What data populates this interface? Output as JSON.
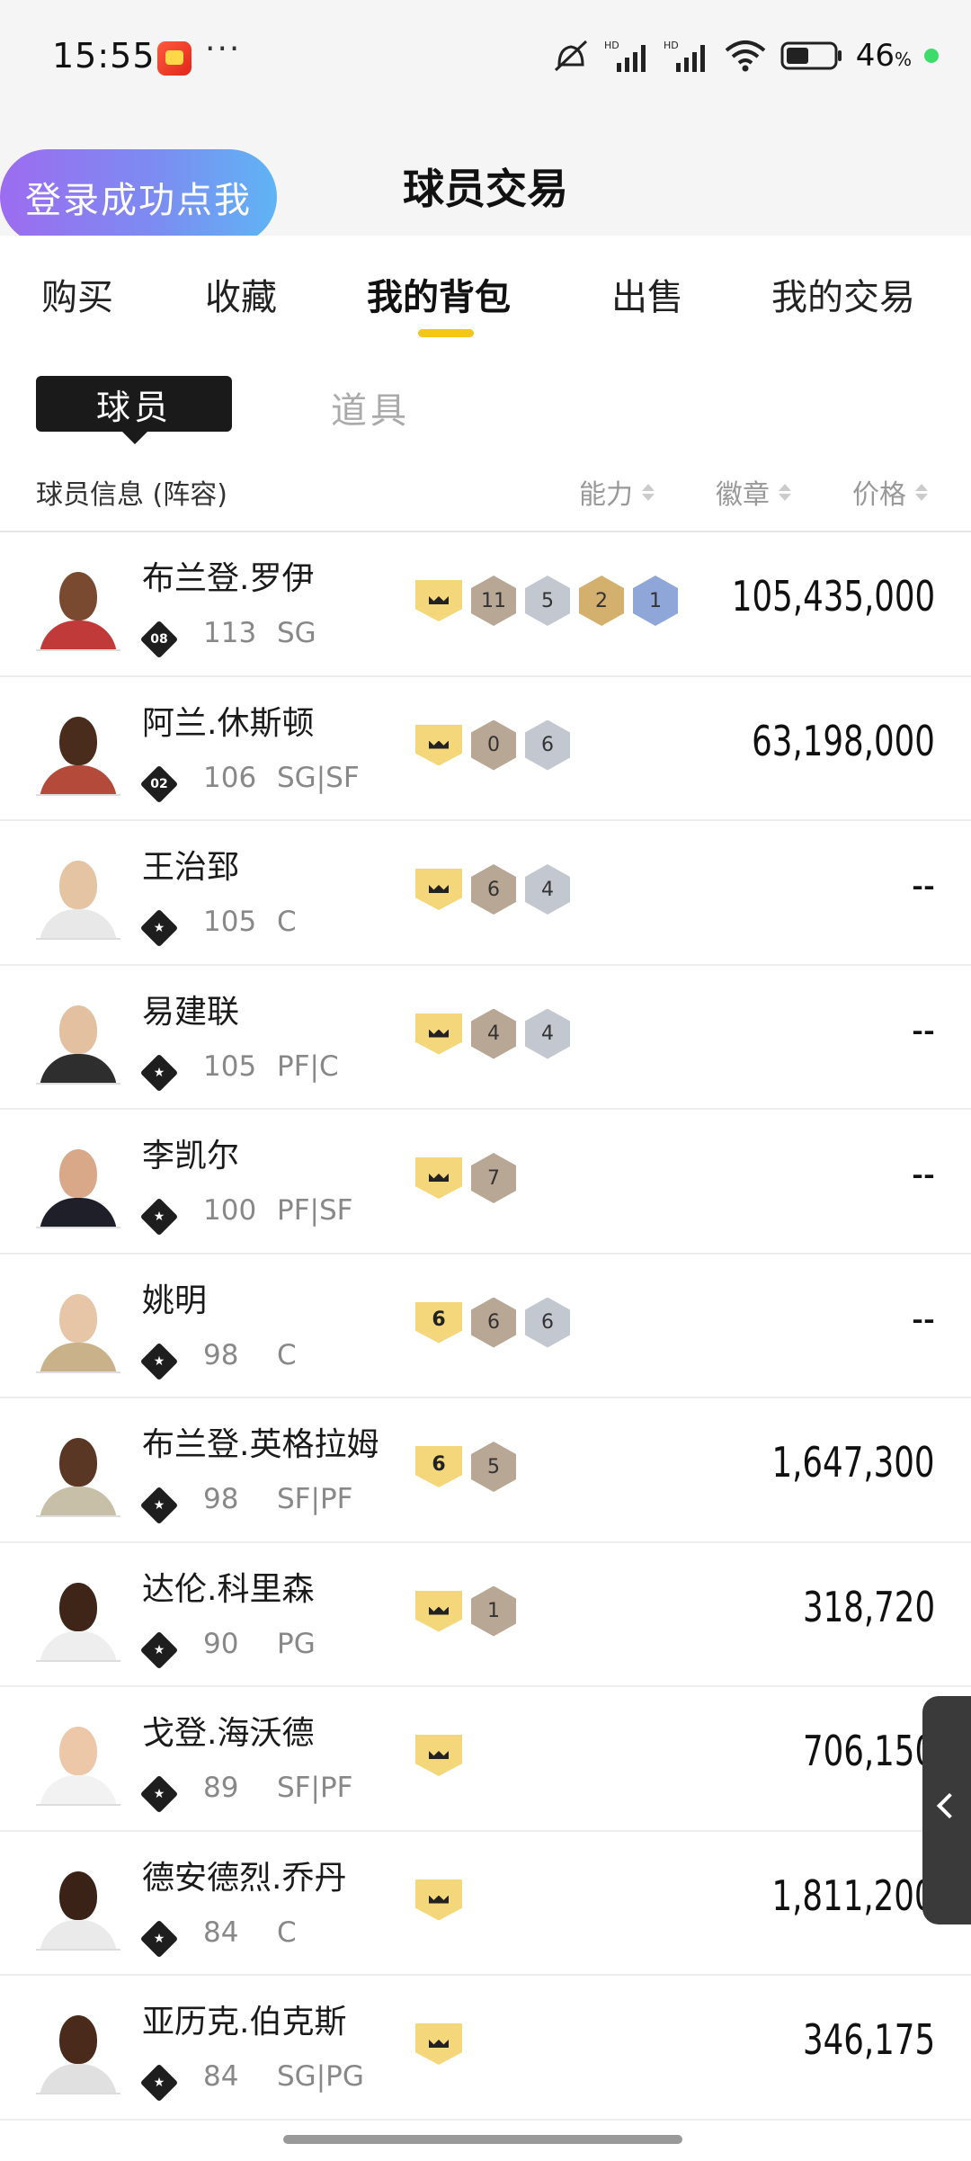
{
  "status_bar": {
    "time": "15:55",
    "dots": "···",
    "battery_percent": "46",
    "battery_unit": "%"
  },
  "header": {
    "login_button": "登录成功点我",
    "title": "球员交易"
  },
  "tabs": [
    {
      "label": "购买",
      "active": false
    },
    {
      "label": "收藏",
      "active": false
    },
    {
      "label": "我的背包",
      "active": true
    },
    {
      "label": "出售",
      "active": false
    },
    {
      "label": "我的交易",
      "active": false
    }
  ],
  "subtabs": {
    "player": "球员",
    "item": "道具"
  },
  "columns": {
    "info": "球员信息 (阵容)",
    "ability": "能力",
    "badge": "徽章",
    "price": "价格"
  },
  "colors": {
    "accent_yellow": "#f5c518",
    "badge_gold": "#f4d77a",
    "pill_left": "#9c6cf0",
    "pill_right": "#5fb4f4"
  },
  "players": [
    {
      "name": "布兰登.罗伊",
      "tier_label": "08",
      "rating": "113",
      "position": "SG",
      "crown": "",
      "badges": [
        {
          "v": "11",
          "c": "bronze"
        },
        {
          "v": "5",
          "c": "silver"
        },
        {
          "v": "2",
          "c": "gold"
        },
        {
          "v": "1",
          "c": "blue"
        }
      ],
      "price": "105,435,000",
      "skin": "#7a4a30",
      "jersey": "#c03a3a"
    },
    {
      "name": "阿兰.休斯顿",
      "tier_label": "02",
      "rating": "106",
      "position": "SG|SF",
      "crown": "",
      "badges": [
        {
          "v": "0",
          "c": "bronze"
        },
        {
          "v": "6",
          "c": "silver"
        }
      ],
      "price": "63,198,000",
      "skin": "#4a2c1c",
      "jersey": "#b34a3a"
    },
    {
      "name": "王治郅",
      "tier_label": "",
      "rating": "105",
      "position": "C",
      "crown": "",
      "badges": [
        {
          "v": "6",
          "c": "bronze"
        },
        {
          "v": "4",
          "c": "silver"
        }
      ],
      "price": "--",
      "skin": "#e5c4a4",
      "jersey": "#e8e8e8"
    },
    {
      "name": "易建联",
      "tier_label": "",
      "rating": "105",
      "position": "PF|C",
      "crown": "",
      "badges": [
        {
          "v": "4",
          "c": "bronze"
        },
        {
          "v": "4",
          "c": "silver"
        }
      ],
      "price": "--",
      "skin": "#e2c0a0",
      "jersey": "#2e2e2e"
    },
    {
      "name": "李凯尔",
      "tier_label": "",
      "rating": "100",
      "position": "PF|SF",
      "crown": "",
      "badges": [
        {
          "v": "7",
          "c": "bronze"
        }
      ],
      "price": "--",
      "skin": "#d8a888",
      "jersey": "#1f1f2a"
    },
    {
      "name": "姚明",
      "tier_label": "",
      "rating": "98",
      "position": "C",
      "crown": "6",
      "badges": [
        {
          "v": "6",
          "c": "bronze"
        },
        {
          "v": "6",
          "c": "silver"
        }
      ],
      "price": "--",
      "skin": "#e6c6a6",
      "jersey": "#c9b28a"
    },
    {
      "name": "布兰登.英格拉姆",
      "tier_label": "",
      "rating": "98",
      "position": "SF|PF",
      "crown": "6",
      "badges": [
        {
          "v": "5",
          "c": "bronze"
        }
      ],
      "price": "1,647,300",
      "skin": "#5a3624",
      "jersey": "#c8bfa8"
    },
    {
      "name": "达伦.科里森",
      "tier_label": "",
      "rating": "90",
      "position": "PG",
      "crown": "",
      "badges": [
        {
          "v": "1",
          "c": "bronze"
        }
      ],
      "price": "318,720",
      "skin": "#3e2518",
      "jersey": "#eeeeee"
    },
    {
      "name": "戈登.海沃德",
      "tier_label": "",
      "rating": "89",
      "position": "SF|PF",
      "crown": "",
      "badges": [],
      "price": "706,150",
      "skin": "#ecc7a8",
      "jersey": "#f2f2f2"
    },
    {
      "name": "德安德烈.乔丹",
      "tier_label": "",
      "rating": "84",
      "position": "C",
      "crown": "",
      "badges": [],
      "price": "1,811,200",
      "skin": "#3a2216",
      "jersey": "#eaeaea"
    },
    {
      "name": "亚历克.伯克斯",
      "tier_label": "",
      "rating": "84",
      "position": "SG|PG",
      "crown": "",
      "badges": [],
      "price": "346,175",
      "skin": "#4a2a1a",
      "jersey": "#e0e0e0"
    }
  ]
}
